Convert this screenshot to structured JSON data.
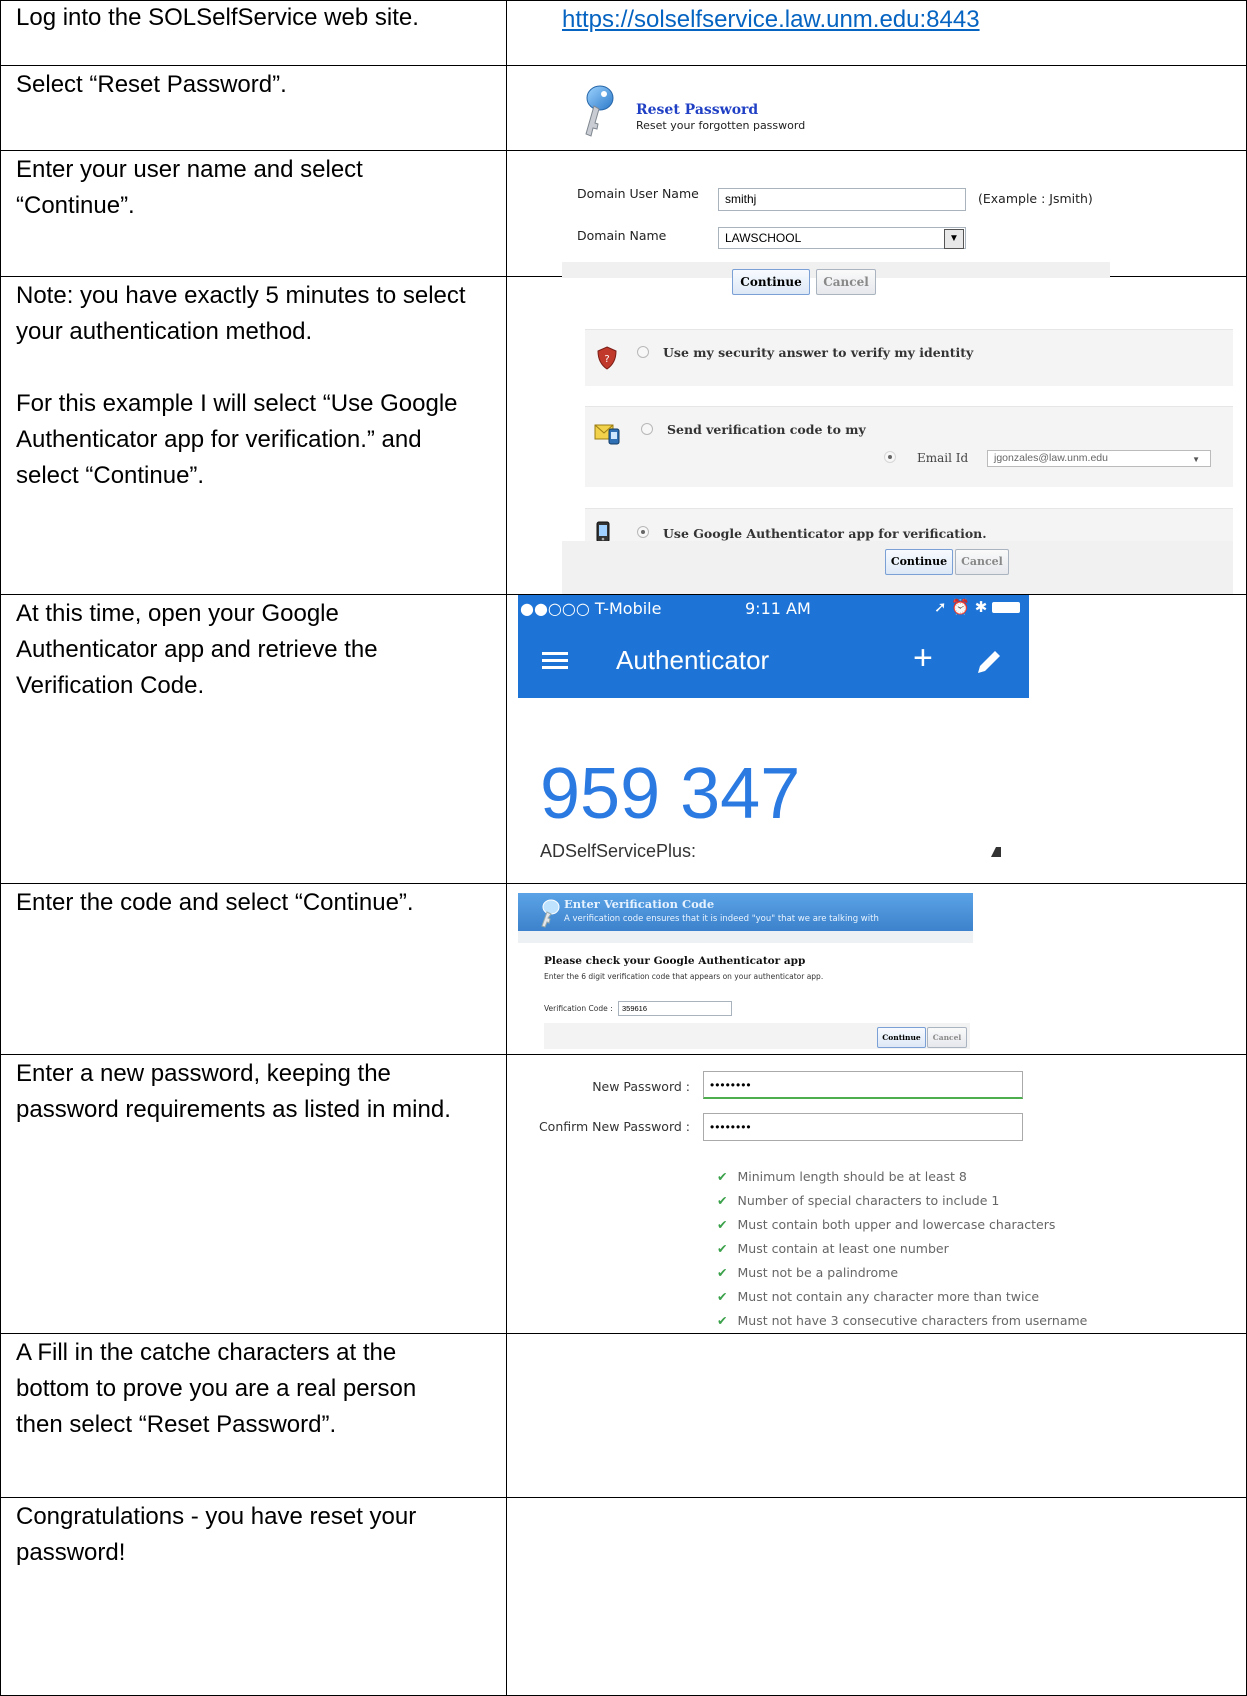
{
  "rows": [
    {
      "lines": [
        "Log into the SOLSelfService web site."
      ],
      "url": "https://solselfservice.law.unm.edu:8443"
    },
    {
      "lines": [
        "Select “Reset Password”."
      ]
    },
    {
      "lines": [
        "Enter your user name and select",
        "“Continue”."
      ]
    },
    {
      "lines": [
        "Note: you have exactly 5 minutes to select",
        "your authentication method.",
        "",
        "For this example I will select “Use Google",
        "Authenticator app for verification.” and",
        "select “Continue”."
      ]
    },
    {
      "lines": [
        "At this time, open your Google",
        "Authenticator app and retrieve the",
        "Verification Code."
      ]
    },
    {
      "lines": [
        "Enter the code and select “Continue”."
      ]
    },
    {
      "lines": [
        "Enter a new password, keeping the",
        "password requirements as listed in mind."
      ]
    },
    {
      "lines": [
        "A Fill in the catche characters at the",
        "bottom to prove you are a real person",
        "then select “Reset Password”."
      ]
    },
    {
      "lines": [
        "Congratulations  - you have reset your",
        "password!"
      ]
    }
  ],
  "reset": {
    "title": "Reset Password",
    "subtitle": "Reset your forgotten password"
  },
  "login": {
    "user_label": "Domain User Name",
    "user_value": "smithj",
    "example": "(Example : Jsmith)",
    "domain_label": "Domain Name",
    "domain_value": "LAWSCHOOL",
    "continue": "Continue",
    "cancel": "Cancel"
  },
  "auth": {
    "opt1": "Use my security answer to verify my identity",
    "opt2": "Send verification code to my",
    "email_label": "Email Id",
    "email_value": "jgonzales@law.unm.edu",
    "opt3": "Use Google Authenticator app for verification.",
    "continue": "Continue",
    "cancel": "Cancel"
  },
  "phone": {
    "carrier": "●●○○○ T-Mobile",
    "time": "9:11 AM",
    "app_title": "Authenticator",
    "code": "959 347",
    "account": "ADSelfServicePlus:"
  },
  "verify": {
    "header_title": "Enter Verification Code",
    "header_sub": "A verification code ensures that it is indeed \"you\" that we are talking with",
    "heading": "Please check your Google Authenticator app",
    "instruction": "Enter the 6 digit verification code that appears on your authenticator app.",
    "code_label": "Verification Code :",
    "code_value": "359616",
    "continue": "Continue",
    "cancel": "Cancel"
  },
  "password": {
    "new_label": "New Password :",
    "new_value": "••••••••",
    "confirm_label": "Confirm New Password :",
    "confirm_value": "••••••••",
    "requirements": [
      "Minimum length should be at least 8",
      "Number of special characters to include 1",
      "Must contain both upper and lowercase characters",
      "Must contain at least one number",
      "Must not be a palindrome",
      "Must not contain any character more than twice",
      "Must not have 3 consecutive characters from username"
    ]
  }
}
